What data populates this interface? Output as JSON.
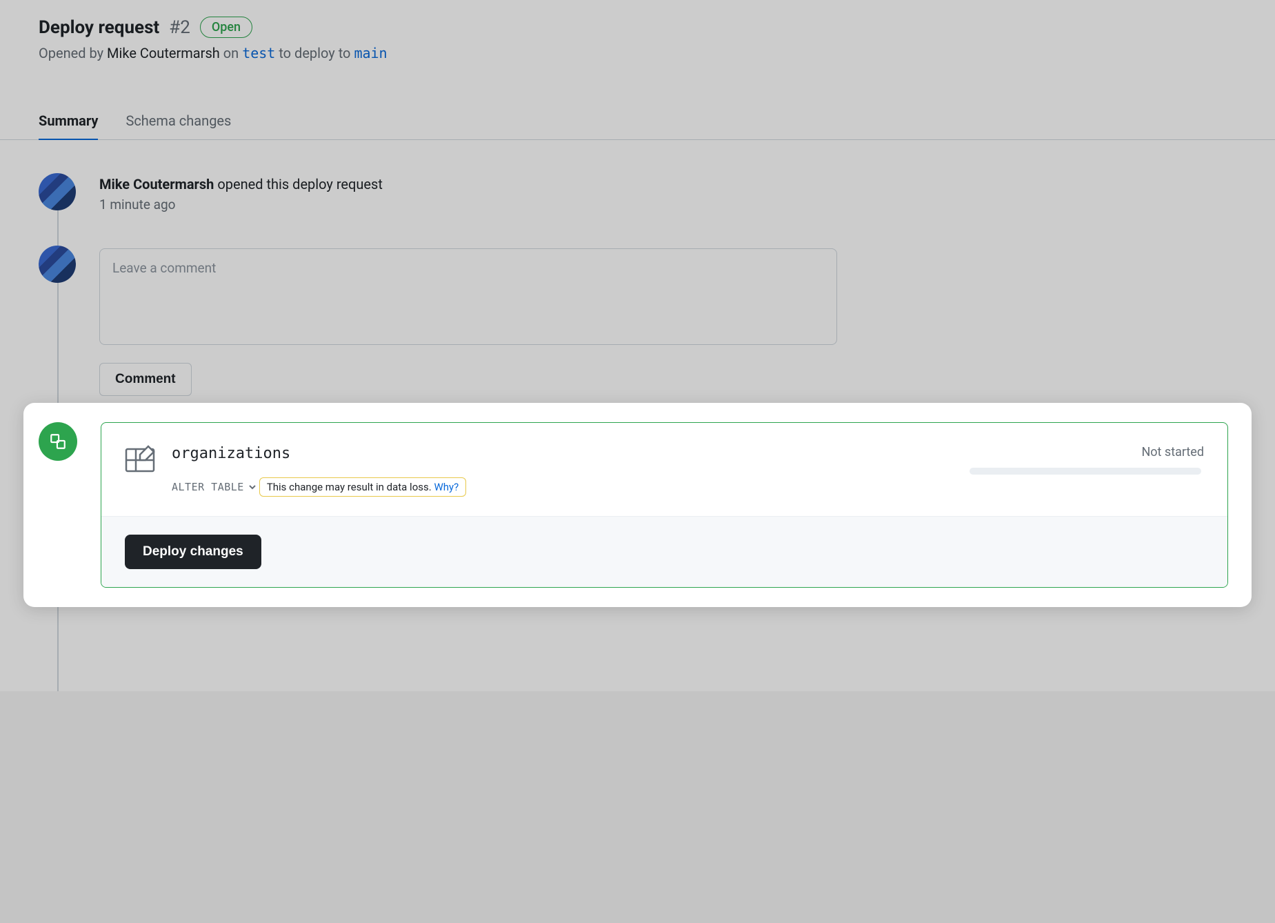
{
  "header": {
    "title": "Deploy request",
    "number": "#2",
    "status": "Open",
    "opened_prefix": "Opened by",
    "author": "Mike Coutermarsh",
    "on_word": "on",
    "from_branch": "test",
    "to_phrase": "to deploy to",
    "to_branch": "main"
  },
  "tabs": {
    "summary": "Summary",
    "schema_changes": "Schema changes"
  },
  "timeline": {
    "opened_event": {
      "actor": "Mike Coutermarsh",
      "action": "opened this deploy request",
      "time": "1 minute ago"
    },
    "comment_placeholder": "Leave a comment",
    "comment_button": "Comment"
  },
  "deploy": {
    "table_name": "organizations",
    "operation": "ALTER TABLE",
    "warning_text": "This change may result in data loss.",
    "warning_link": "Why?",
    "status": "Not started",
    "button": "Deploy changes"
  }
}
